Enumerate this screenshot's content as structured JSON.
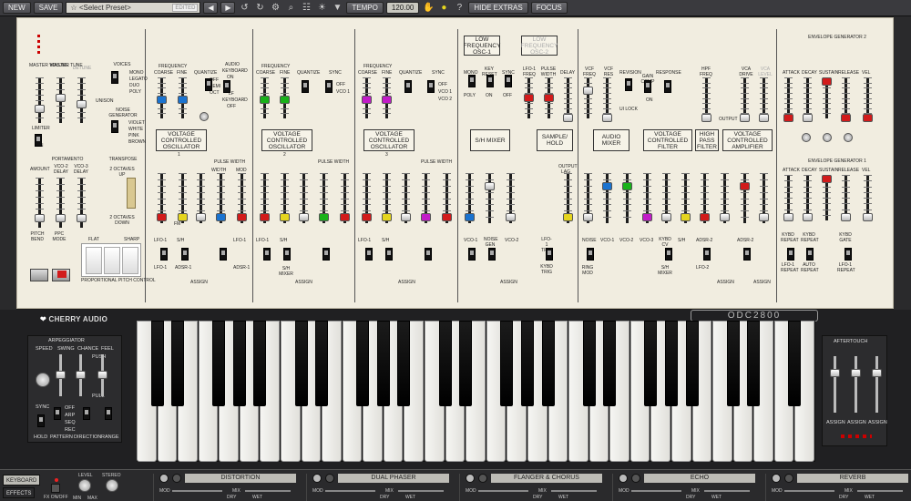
{
  "toolbar": {
    "new": "NEW",
    "save": "SAVE",
    "preset": "☆ <Select Preset>",
    "edited": "EDITED",
    "prev": "◀",
    "next": "▶",
    "tempo": "TEMPO",
    "tempo_value": "120.00",
    "hide_extras": "HIDE EXTRAS",
    "focus": "FOCUS"
  },
  "panel": {
    "master": {
      "volume": "MASTER VOLUME",
      "tune": "MASTER TUNE",
      "detune": "DETUNE",
      "limiter": "LIMITER",
      "on": "ON",
      "voices": "VOICES",
      "voices_opts": [
        "MONO",
        "LEGATO",
        "DUO",
        "POLY"
      ],
      "unison": "UNISON",
      "noise": "NOISE GENERATOR",
      "noise_opts": [
        "VIOLET",
        "WHITE",
        "PINK",
        "BROWN"
      ],
      "portamento": "PORTAMENTO",
      "amount": "AMOUNT",
      "vco2": "VCO-2 DELAY",
      "vco3": "VCO-3 DELAY",
      "transpose": "TRANSPOSE",
      "up": "2 OCTAVES UP",
      "down": "2 OCTAVES DOWN",
      "pitch_bend": "PITCH BEND",
      "ppc_mode": "PPC MODE",
      "flat": "FLAT",
      "sharp": "SHARP",
      "ppc": "PROPORTIONAL PITCH CONTROL"
    },
    "vco1": {
      "frequency": "FREQUENCY",
      "coarse": "COARSE",
      "fine": "FINE",
      "quantize": "QUANTIZE",
      "audio": "AUDIO",
      "keyboard": "KEYBOARD",
      "on": "ON",
      "lf": "LF",
      "keyboard2": "KEYBOARD",
      "off": "OFF",
      "title": "VOLTAGE CONTROLLED OSCILLATOR",
      "num": "1",
      "pulse": "PULSE WIDTH",
      "width": "WIDTH",
      "mod": "MOD",
      "fm": "FM",
      "lfo1": "LFO-1",
      "sh": "S/H",
      "adsr1": "ADSR-1",
      "assign": "ASSIGN",
      "qopts": [
        "OFF",
        "SEMI",
        "OCT"
      ]
    },
    "vco2": {
      "title": "VOLTAGE CONTROLLED OSCILLATOR",
      "num": "2",
      "sync": "SYNC",
      "sopts": [
        "OFF",
        "VCO 1"
      ],
      "mixer": "S/H MIXER"
    },
    "vco3": {
      "title": "VOLTAGE CONTROLLED OSCILLATOR",
      "num": "3",
      "sopts": [
        "OFF",
        "VCO 1",
        "VCO 2"
      ]
    },
    "lfo": {
      "lfo1": "LOW FREQUENCY OSC-1",
      "lfo2": "LOW FREQUENCY OSC-2",
      "mono": "MONO",
      "poly": "POLY",
      "keyreset": "KEY RESET",
      "on": "ON",
      "sync": "SYNC",
      "off": "OFF",
      "lfo1freq": "LFO-1 FREQ",
      "pulse": "PULSE WIDTH",
      "delay": "DELAY",
      "shmixer": "S/H MIXER",
      "sample": "SAMPLE/ HOLD",
      "output": "OUTPUT LAG",
      "vco1": "VCO-1",
      "noise": "NOISE GEN",
      "vco2": "VCO-2",
      "kybd": "KYBD TRIG",
      "lfo1trig": "LFO-1 TRIG"
    },
    "filter": {
      "vcffreq": "VCF FREQ",
      "vcfres": "VCF RES",
      "revision": "REVISION",
      "gain": "GAIN COMP",
      "on": "ON",
      "response": "RESPONSE",
      "audio": "AUDIO MIXER",
      "vcf": "VOLTAGE CONTROLLED FILTER",
      "hpf": "HIGH PASS FILTER",
      "hpffreq": "HPF FREQ",
      "vca": "VOLTAGE CONTROLLED AMPLIFIER",
      "vcadrive": "VCA DRIVE",
      "vcalevel": "VCA LEVEL",
      "lfo1": "LFO-1",
      "ringmod": "RING MOD",
      "noise": "NOISE",
      "vco1": "VCO-1",
      "vco2": "VCO-2",
      "vco3": "VCO-3",
      "kybdcv": "KYBD CV",
      "sh": "S/H",
      "adsr2": "ADSR-2",
      "mixer": "S/H MIXER",
      "lfo2": "LFO-2",
      "kybd": "KYBD",
      "ulock": "UI LOCK",
      "output": "OUTPUT"
    },
    "env": {
      "env2": "ENVELOPE GENERATOR 2",
      "env1": "ENVELOPE GENERATOR 1",
      "adsr": "ADSR",
      "attack": "ATTACK",
      "decay": "DECAY",
      "sustain": "SUSTAIN",
      "release": "RELEASE",
      "vel": "VEL",
      "adsr1": "ADSR-1",
      "kybd": "KYBD REPEAT",
      "adsr2": "ADSR-2",
      "kybdgate": "KYBD GATE",
      "lfo1": "LFO-1 REPEAT",
      "auto": "AUTO REPEAT"
    }
  },
  "keyboard_area": {
    "logo": "CHERRY AUDIO",
    "model": "ODC2800",
    "arpeggiator": "ARPEGGIATOR",
    "speed": "SPEED",
    "swing": "SWING",
    "chance": "CHANCE",
    "feel": "FEEL",
    "push": "PUSH",
    "pull": "PULL",
    "off": "OFF",
    "on": "ON",
    "up": "UP",
    "down": "DOWN",
    "sync": "SYNC",
    "hold": "HOLD",
    "pattern": "PATTERN",
    "direction": "DIRECTION",
    "range": "RANGE",
    "arp": "ARP",
    "seq": "SEQ",
    "rec": "REC",
    "rnd": "RND",
    "aftertouch": "AFTERTOUCH",
    "assign": "ASSIGN"
  },
  "effects": {
    "keyboard": "KEYBOARD",
    "effects": "EFFECTS",
    "fxonoff": "FX ON/OFF",
    "level": "LEVEL",
    "stereo": "STEREO",
    "min": "MIN",
    "max": "MAX",
    "slots": [
      {
        "name": "DISTORTION",
        "mod": "MOD",
        "mix": "MIX",
        "dry": "DRY",
        "wet": "WET"
      },
      {
        "name": "DUAL PHASER",
        "mod": "MOD",
        "mix": "MIX",
        "dry": "DRY",
        "wet": "WET"
      },
      {
        "name": "FLANGER & CHORUS",
        "mod": "MOD",
        "mix": "MIX",
        "dry": "DRY",
        "wet": "WET"
      },
      {
        "name": "ECHO",
        "mod": "MOD",
        "mix": "MIX",
        "dry": "DRY",
        "wet": "WET"
      },
      {
        "name": "REVERB",
        "mod": "MOD",
        "mix": "MIX",
        "dry": "DRY",
        "wet": "WET"
      }
    ]
  }
}
